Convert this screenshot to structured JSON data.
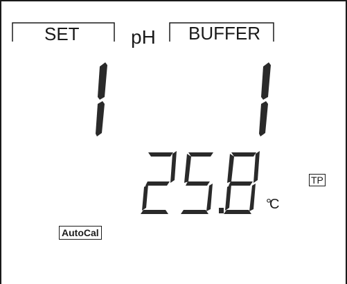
{
  "display": {
    "set_label": "SET",
    "unit_label": "pH",
    "buffer_label": "BUFFER",
    "main_value": "1 1",
    "temperature": "25.8",
    "temperature_unit": "°C",
    "tp_indicator": "TP",
    "autocal_indicator": "AutoCal"
  },
  "colors": {
    "background": "#ffffff",
    "segment": "#2a2a2a",
    "frame": "#1a1a1a"
  }
}
